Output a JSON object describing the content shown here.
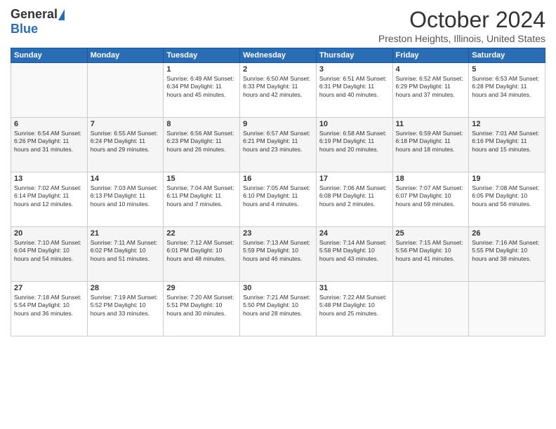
{
  "header": {
    "logo_general": "General",
    "logo_blue": "Blue",
    "title": "October 2024",
    "location": "Preston Heights, Illinois, United States"
  },
  "days_of_week": [
    "Sunday",
    "Monday",
    "Tuesday",
    "Wednesday",
    "Thursday",
    "Friday",
    "Saturday"
  ],
  "weeks": [
    [
      {
        "day": "",
        "info": ""
      },
      {
        "day": "",
        "info": ""
      },
      {
        "day": "1",
        "info": "Sunrise: 6:49 AM\nSunset: 6:34 PM\nDaylight: 11 hours\nand 45 minutes."
      },
      {
        "day": "2",
        "info": "Sunrise: 6:50 AM\nSunset: 6:33 PM\nDaylight: 11 hours\nand 42 minutes."
      },
      {
        "day": "3",
        "info": "Sunrise: 6:51 AM\nSunset: 6:31 PM\nDaylight: 11 hours\nand 40 minutes."
      },
      {
        "day": "4",
        "info": "Sunrise: 6:52 AM\nSunset: 6:29 PM\nDaylight: 11 hours\nand 37 minutes."
      },
      {
        "day": "5",
        "info": "Sunrise: 6:53 AM\nSunset: 6:28 PM\nDaylight: 11 hours\nand 34 minutes."
      }
    ],
    [
      {
        "day": "6",
        "info": "Sunrise: 6:54 AM\nSunset: 6:26 PM\nDaylight: 11 hours\nand 31 minutes."
      },
      {
        "day": "7",
        "info": "Sunrise: 6:55 AM\nSunset: 6:24 PM\nDaylight: 11 hours\nand 29 minutes."
      },
      {
        "day": "8",
        "info": "Sunrise: 6:56 AM\nSunset: 6:23 PM\nDaylight: 11 hours\nand 26 minutes."
      },
      {
        "day": "9",
        "info": "Sunrise: 6:57 AM\nSunset: 6:21 PM\nDaylight: 11 hours\nand 23 minutes."
      },
      {
        "day": "10",
        "info": "Sunrise: 6:58 AM\nSunset: 6:19 PM\nDaylight: 11 hours\nand 20 minutes."
      },
      {
        "day": "11",
        "info": "Sunrise: 6:59 AM\nSunset: 6:18 PM\nDaylight: 11 hours\nand 18 minutes."
      },
      {
        "day": "12",
        "info": "Sunrise: 7:01 AM\nSunset: 6:16 PM\nDaylight: 11 hours\nand 15 minutes."
      }
    ],
    [
      {
        "day": "13",
        "info": "Sunrise: 7:02 AM\nSunset: 6:14 PM\nDaylight: 11 hours\nand 12 minutes."
      },
      {
        "day": "14",
        "info": "Sunrise: 7:03 AM\nSunset: 6:13 PM\nDaylight: 11 hours\nand 10 minutes."
      },
      {
        "day": "15",
        "info": "Sunrise: 7:04 AM\nSunset: 6:11 PM\nDaylight: 11 hours\nand 7 minutes."
      },
      {
        "day": "16",
        "info": "Sunrise: 7:05 AM\nSunset: 6:10 PM\nDaylight: 11 hours\nand 4 minutes."
      },
      {
        "day": "17",
        "info": "Sunrise: 7:06 AM\nSunset: 6:08 PM\nDaylight: 11 hours\nand 2 minutes."
      },
      {
        "day": "18",
        "info": "Sunrise: 7:07 AM\nSunset: 6:07 PM\nDaylight: 10 hours\nand 59 minutes."
      },
      {
        "day": "19",
        "info": "Sunrise: 7:08 AM\nSunset: 6:05 PM\nDaylight: 10 hours\nand 56 minutes."
      }
    ],
    [
      {
        "day": "20",
        "info": "Sunrise: 7:10 AM\nSunset: 6:04 PM\nDaylight: 10 hours\nand 54 minutes."
      },
      {
        "day": "21",
        "info": "Sunrise: 7:11 AM\nSunset: 6:02 PM\nDaylight: 10 hours\nand 51 minutes."
      },
      {
        "day": "22",
        "info": "Sunrise: 7:12 AM\nSunset: 6:01 PM\nDaylight: 10 hours\nand 48 minutes."
      },
      {
        "day": "23",
        "info": "Sunrise: 7:13 AM\nSunset: 5:59 PM\nDaylight: 10 hours\nand 46 minutes."
      },
      {
        "day": "24",
        "info": "Sunrise: 7:14 AM\nSunset: 5:58 PM\nDaylight: 10 hours\nand 43 minutes."
      },
      {
        "day": "25",
        "info": "Sunrise: 7:15 AM\nSunset: 5:56 PM\nDaylight: 10 hours\nand 41 minutes."
      },
      {
        "day": "26",
        "info": "Sunrise: 7:16 AM\nSunset: 5:55 PM\nDaylight: 10 hours\nand 38 minutes."
      }
    ],
    [
      {
        "day": "27",
        "info": "Sunrise: 7:18 AM\nSunset: 5:54 PM\nDaylight: 10 hours\nand 36 minutes."
      },
      {
        "day": "28",
        "info": "Sunrise: 7:19 AM\nSunset: 5:52 PM\nDaylight: 10 hours\nand 33 minutes."
      },
      {
        "day": "29",
        "info": "Sunrise: 7:20 AM\nSunset: 5:51 PM\nDaylight: 10 hours\nand 30 minutes."
      },
      {
        "day": "30",
        "info": "Sunrise: 7:21 AM\nSunset: 5:50 PM\nDaylight: 10 hours\nand 28 minutes."
      },
      {
        "day": "31",
        "info": "Sunrise: 7:22 AM\nSunset: 5:48 PM\nDaylight: 10 hours\nand 25 minutes."
      },
      {
        "day": "",
        "info": ""
      },
      {
        "day": "",
        "info": ""
      }
    ]
  ]
}
